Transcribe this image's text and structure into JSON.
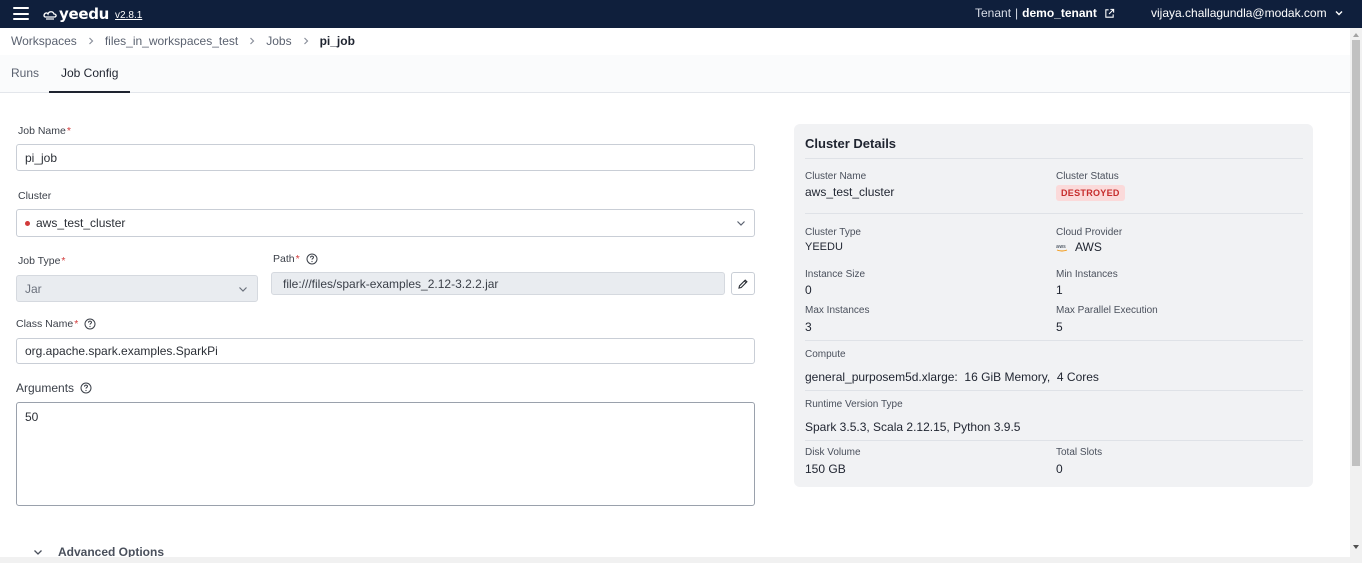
{
  "app": {
    "name": "yeedu",
    "version": "v2.8.1"
  },
  "header": {
    "tenant_label": "Tenant",
    "tenant_sep": "|",
    "tenant_value": "demo_tenant",
    "user_email": "vijaya.challagundla@modak.com"
  },
  "breadcrumb": {
    "items": [
      "Workspaces",
      "files_in_workspaces_test",
      "Jobs"
    ],
    "current": "pi_job"
  },
  "tabs": [
    {
      "label": "Runs",
      "active": false
    },
    {
      "label": "Job Config",
      "active": true
    }
  ],
  "form": {
    "job_name": {
      "label": "Job Name",
      "required": "*",
      "value": "pi_job"
    },
    "cluster": {
      "label": "Cluster",
      "value": "aws_test_cluster",
      "status_color": "#d23a3a"
    },
    "job_type": {
      "label": "Job Type",
      "required": "*",
      "value": "Jar"
    },
    "path": {
      "label": "Path",
      "required": "*",
      "value": "file:///files/spark-examples_2.12-3.2.2.jar"
    },
    "class_name": {
      "label": "Class Name",
      "required": "*",
      "value": "org.apache.spark.examples.SparkPi"
    },
    "arguments": {
      "label": "Arguments",
      "value": "50"
    },
    "advanced_options": "Advanced Options"
  },
  "cluster_details": {
    "title": "Cluster Details",
    "cluster_name": {
      "label": "Cluster Name",
      "value": "aws_test_cluster"
    },
    "cluster_status": {
      "label": "Cluster Status",
      "value": "DESTROYED"
    },
    "cluster_type": {
      "label": "Cluster Type",
      "value": "YEEDU"
    },
    "cloud_provider": {
      "label": "Cloud Provider",
      "value": "AWS",
      "logo_text": "aws"
    },
    "instance_size": {
      "label": "Instance Size",
      "value": "0"
    },
    "min_instances": {
      "label": "Min Instances",
      "value": "1"
    },
    "max_instances": {
      "label": "Max Instances",
      "value": "3"
    },
    "max_parallel_execution": {
      "label": "Max Parallel Execution",
      "value": "5"
    },
    "compute": {
      "label": "Compute",
      "value": "general_purposem5d.xlarge:  16 GiB Memory,  4 Cores"
    },
    "runtime_version_type": {
      "label": "Runtime Version Type",
      "value": "Spark 3.5.3, Scala 2.12.15, Python 3.9.5"
    },
    "disk_volume": {
      "label": "Disk Volume",
      "value": "150 GB"
    },
    "total_slots": {
      "label": "Total Slots",
      "value": "0"
    }
  },
  "colors": {
    "topbar": "#0f1f3c",
    "required": "#d23a3a",
    "status_destroyed_bg": "#fbdada",
    "status_destroyed_text": "#c62c2c"
  }
}
